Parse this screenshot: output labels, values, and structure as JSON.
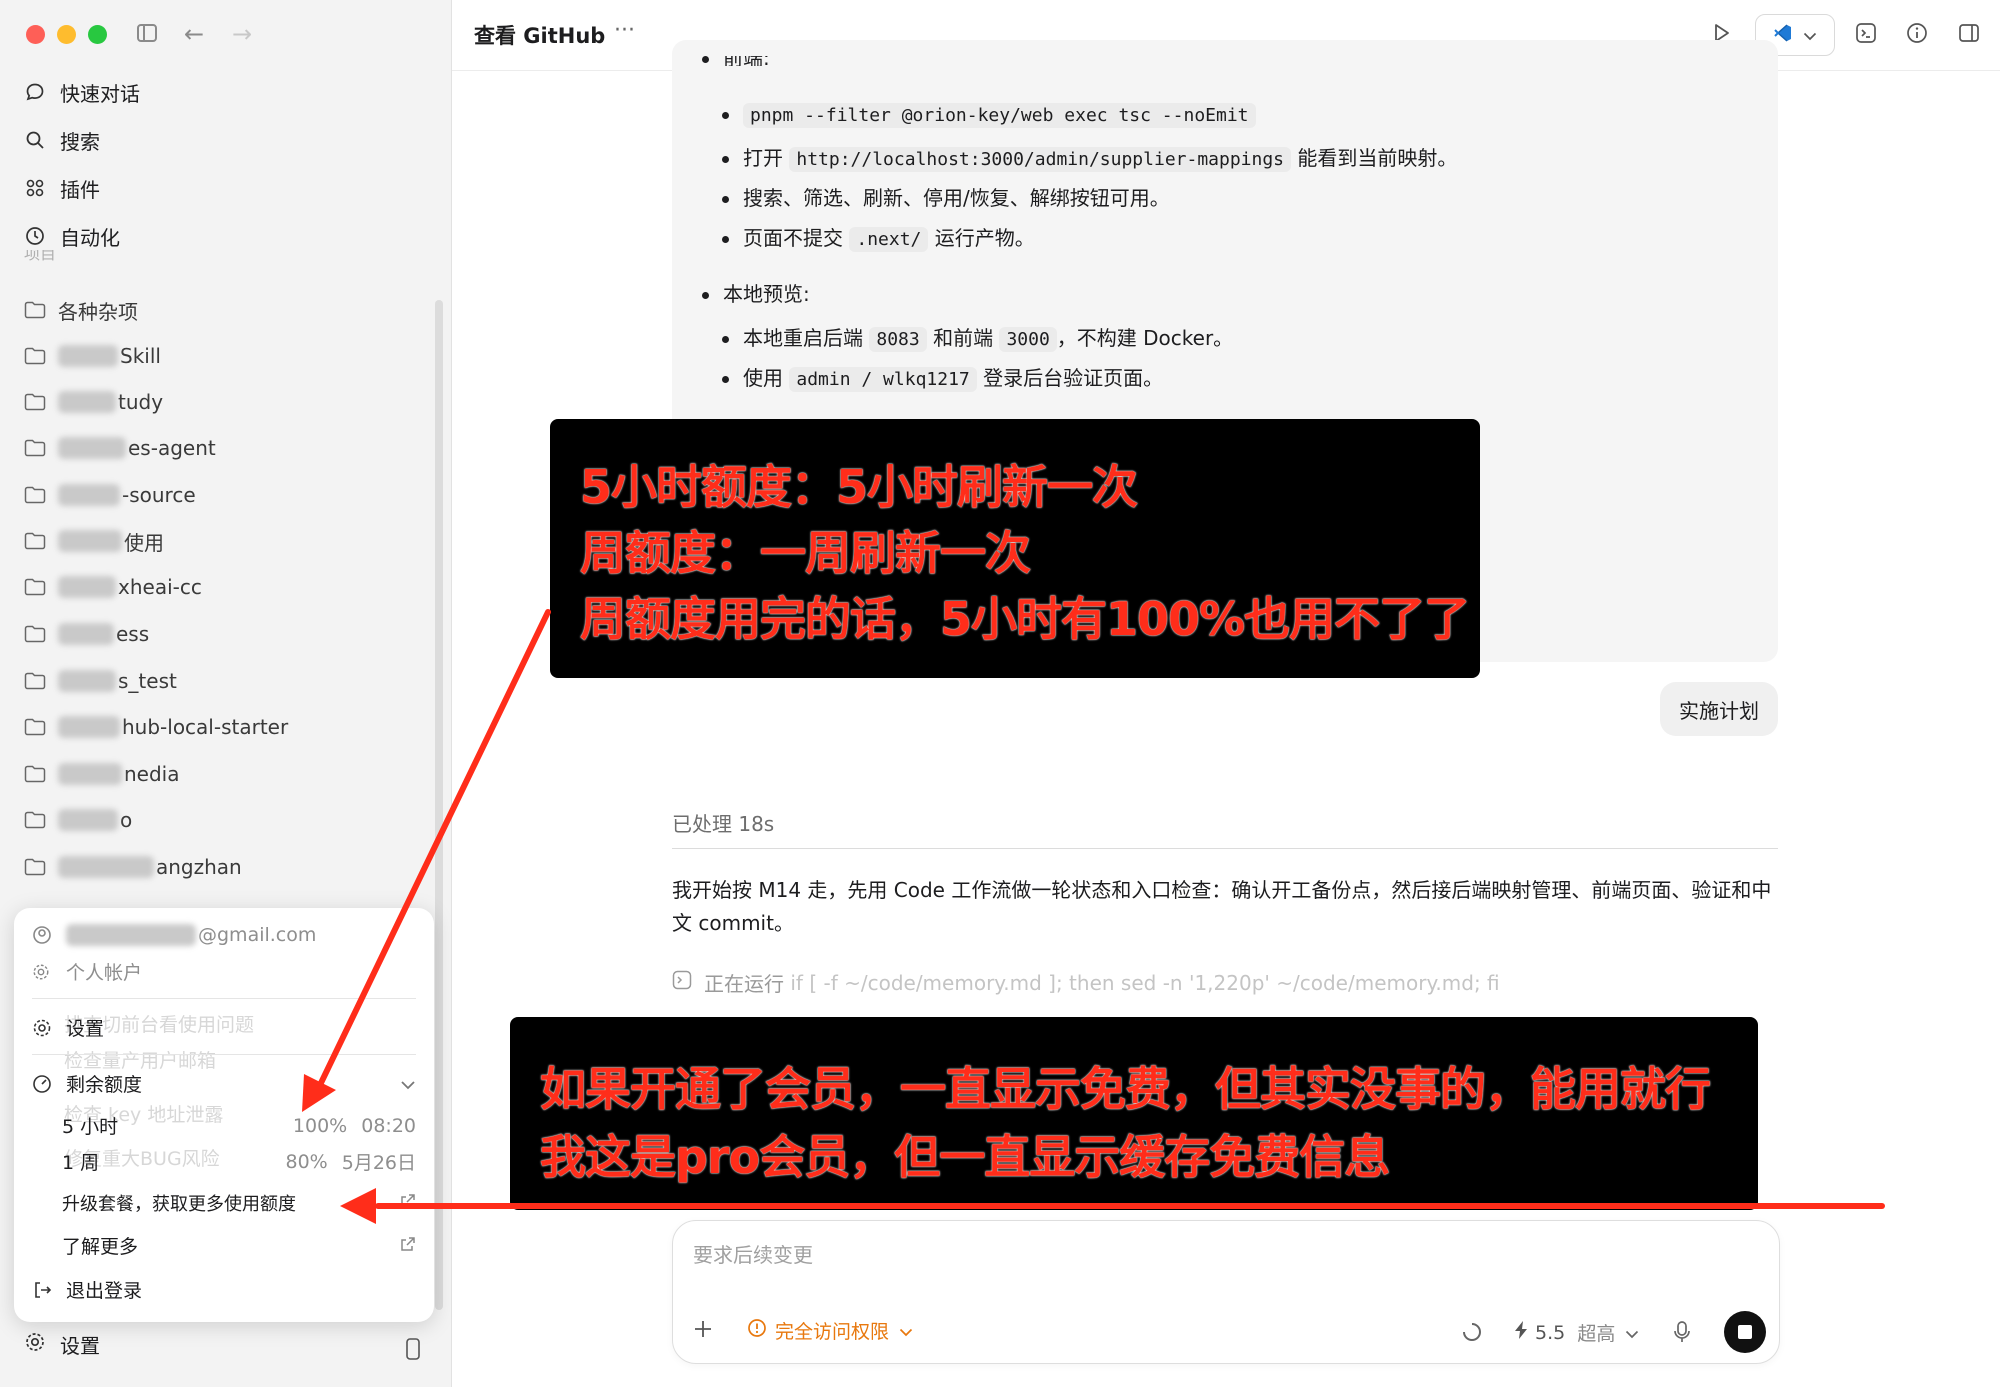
{
  "window": {
    "title": "查看 GitHub",
    "more": "···"
  },
  "sidebar": {
    "nav": [
      {
        "label": "快速对话",
        "icon": "chat-bubble-icon"
      },
      {
        "label": "搜索",
        "icon": "search-icon"
      },
      {
        "label": "插件",
        "icon": "plugins-icon"
      },
      {
        "label": "自动化",
        "icon": "clock-icon"
      }
    ],
    "section_partial": "项目",
    "projects": [
      "各种杂项",
      "Skill",
      "tudy",
      "es-agent",
      "-source",
      "使用",
      "xheai-cc",
      "ess",
      "s_test",
      "hub-local-starter",
      "nedia",
      "o",
      "angzhan"
    ],
    "bottom_settings": "设置"
  },
  "account_menu": {
    "email": "@gmail.com",
    "personal_account": "个人帐户",
    "settings": "设置",
    "remaining_quota": "剩余额度",
    "quotas": [
      {
        "label": "5 小时",
        "percent": "100%",
        "reset": "08:20"
      },
      {
        "label": "1 周",
        "percent": "80%",
        "reset": "5月26日"
      }
    ],
    "upgrade": "升级套餐，获取更多使用额度",
    "learn_more": "了解更多",
    "logout": "退出登录",
    "background_ghost": [
      "排查切前台看使用问题",
      "检查量产用户邮箱",
      "检查 key 地址泄露",
      "修复重大BUG风险"
    ]
  },
  "content": {
    "partial_heading": "前端:",
    "frontend_items": [
      {
        "code": "pnpm --filter @orion-key/web exec tsc --noEmit",
        "pre": "",
        "post": ""
      },
      {
        "pre": "打开",
        "code": "http://localhost:3000/admin/supplier-mappings",
        "post": "能看到当前映射。"
      },
      {
        "pre": "搜索、筛选、刷新、停用/恢复、解绑按钮可用。",
        "code": "",
        "post": ""
      },
      {
        "pre": "页面不提交",
        "code": ".next/",
        "post": "运行产物。"
      }
    ],
    "local_preview": "本地预览:",
    "preview_items": [
      {
        "p1": "本地重启后端",
        "c1": "8083",
        "p2": "和前端",
        "c2": "3000",
        "p3": "，不构建 Docker。"
      },
      {
        "p1": "使用",
        "c1": "admin / wlkq1217",
        "p2": "登录后台验证页面。",
        "c2": "",
        "p3": ""
      }
    ],
    "implement_pill": "实施计划",
    "processed": "已处理 18s",
    "paragraph": "我开始按 M14 走，先用 Code 工作流做一轮状态和入口检查：确认开工备份点，然后接后端映射管理、前端页面、验证和中文 commit。",
    "running_prefix": "正在运行",
    "running_cmd": "if [ -f ~/code/memory.md ]; then sed -n '1,220p' ~/code/memory.md; fi"
  },
  "composer": {
    "placeholder": "要求后续变更",
    "access": "完全访问权限",
    "model": "5.5",
    "effort": "超高"
  },
  "annotations": {
    "box1": [
      "5小时额度：5小时刷新一次",
      "周额度：一周刷新一次",
      "周额度用完的话，5小时有100%也用不了了"
    ],
    "box2": [
      "如果开通了会员，一直显示免费，但其实没事的，能用就行",
      "我这是pro会员，但一直显示缓存免费信息"
    ]
  },
  "colors": {
    "annotation_red": "#ff2d1a",
    "annotation_bg": "#000000"
  }
}
